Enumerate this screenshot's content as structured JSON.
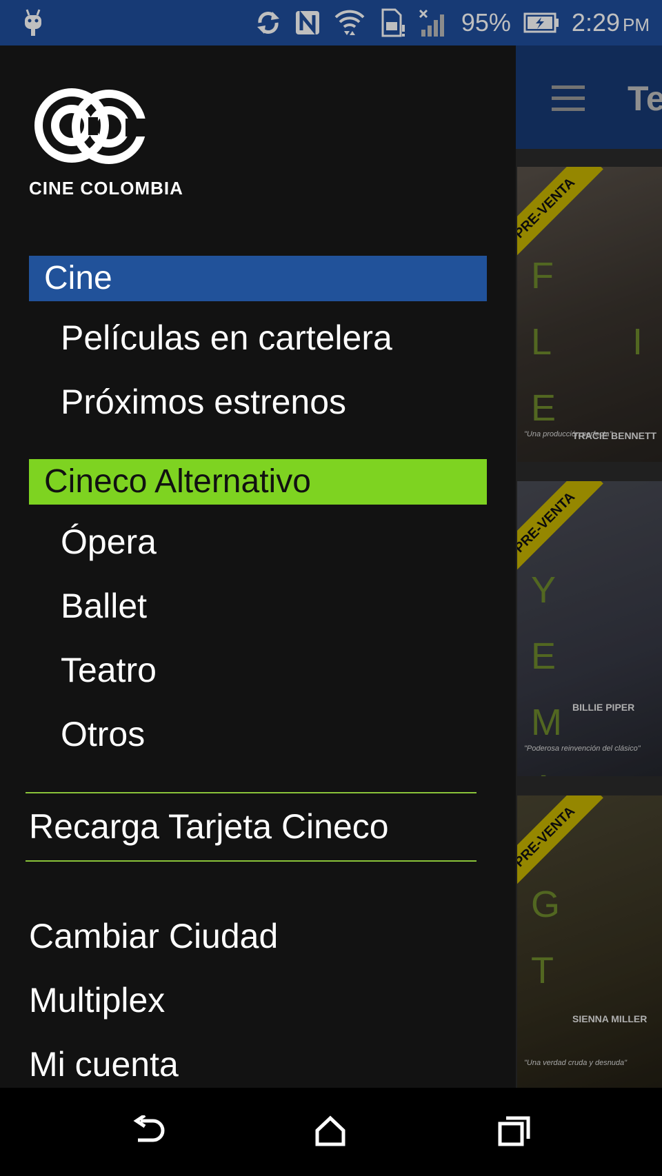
{
  "status_bar": {
    "battery_percent": "95%",
    "time": "2:29",
    "ampm": "PM",
    "icons": [
      "android-icon",
      "sync-icon",
      "nfc-icon",
      "wifi-icon",
      "sim-icon",
      "signal-icon",
      "battery-icon"
    ]
  },
  "background_app": {
    "title": "Te",
    "posters": [
      {
        "badge": "PRE-VENTA",
        "letters": "F L I E",
        "actor": "TRACIE BENNETT",
        "quote": "\"Una producción perfecta\""
      },
      {
        "badge": "PRE-VENTA",
        "letters": "Y E M A",
        "actor": "BILLIE PIPER",
        "quote": "\"Poderosa reinvención del clásico\""
      },
      {
        "badge": "PRE-VENTA",
        "letters": "G T",
        "actor": "SIENNA MILLER",
        "quote": "\"Una verdad cruda y desnuda\""
      }
    ]
  },
  "drawer": {
    "logo_text": "CINE COLOMBIA",
    "sections": [
      {
        "header": "Cine",
        "items": [
          "Películas en cartelera",
          "Próximos estrenos"
        ]
      },
      {
        "header": "Cineco Alternativo",
        "items": [
          "Ópera",
          "Ballet",
          "Teatro",
          "Otros"
        ]
      }
    ],
    "recharge_label": "Recarga Tarjeta Cineco",
    "bottom_items": [
      "Cambiar Ciudad",
      "Multiplex",
      "Mi cuenta"
    ]
  },
  "colors": {
    "status_bar": "#1f4e9c",
    "cine_header": "#21529a",
    "alternativo_header": "#7ed321",
    "divider": "#8ac43a"
  }
}
